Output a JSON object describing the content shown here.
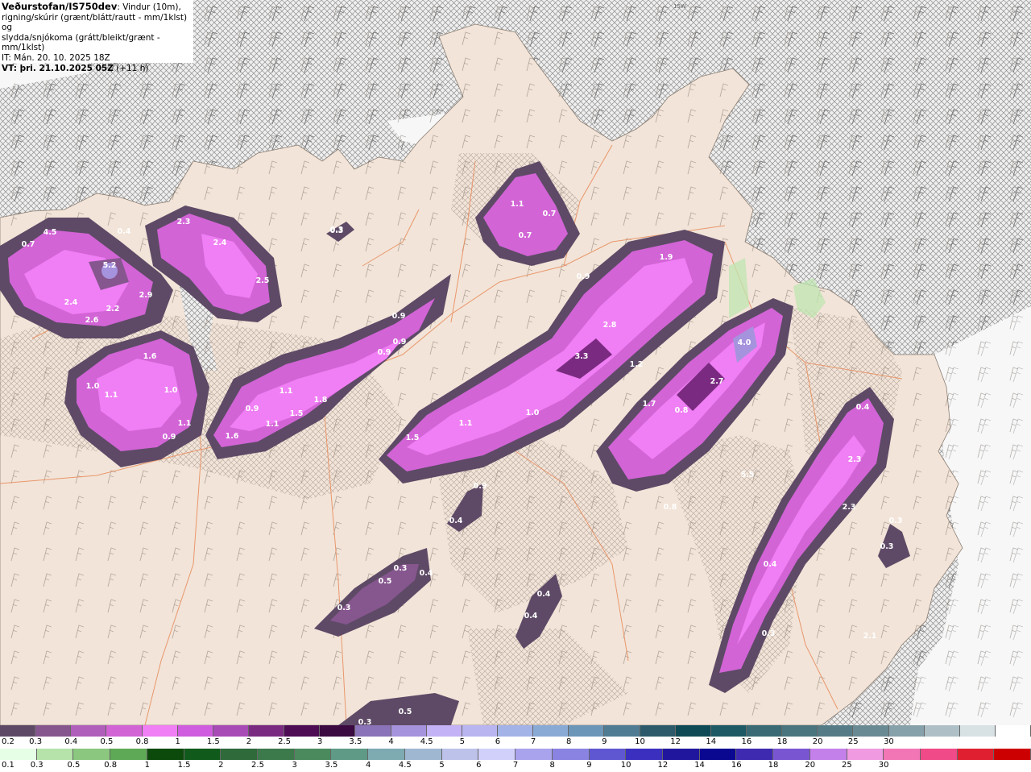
{
  "header": {
    "org": "Veðurstofan/IS750dev",
    "desc1": ": Vindur (10m),",
    "desc2": "rigning/skúrir (grænt/blátt/rautt - mm/1klst) og",
    "desc3": "slydda/snjókoma (grátt/bleikt/grænt - mm/1klst)",
    "it": "IT: Mán. 20. 10. 2025 18Z",
    "vt": "VT: þri. 21.10.2025 05Z",
    "lead": "(+11 h)"
  },
  "map_labels": [
    "0.7",
    "4.5",
    "0.4",
    "2.3",
    "2.4",
    "5.2",
    "2.5",
    "2.4",
    "2.2",
    "2.9",
    "2.6",
    "0.3",
    "1.1",
    "0.7",
    "0.7",
    "0.9",
    "1.9",
    "0.9",
    "0.9",
    "0.9",
    "2.8",
    "3.3",
    "1.2",
    "1.6",
    "1.0",
    "1.1",
    "1.0",
    "1.1",
    "0.9",
    "0.9",
    "1.1",
    "1.8",
    "1.5",
    "1.6",
    "1.1",
    "1.1",
    "1.5",
    "1.0",
    "1.7",
    "0.8",
    "2.7",
    "4.0",
    "5.5",
    "0.8",
    "0.4",
    "2.3",
    "2.3",
    "0.9",
    "0.4",
    "0.3",
    "0.3",
    "0.5",
    "0.4",
    "0.3",
    "0.3",
    "0.4",
    "0.4",
    "0.4",
    "0.3",
    "2.1",
    "0.5",
    "0.3",
    "0.3",
    "0.3"
  ],
  "snow_legend": {
    "colors": [
      "#5e4a66",
      "#86568e",
      "#b05fba",
      "#d264d6",
      "#f07ef4",
      "#d05cdf",
      "#a84bb6",
      "#7a2a80",
      "#4e0c55",
      "#3a0a40",
      "#8a73b8",
      "#a693dd",
      "#c3b2f5",
      "#b9b5f0",
      "#a3b3e8",
      "#8aaad6",
      "#6c96b8",
      "#4f7c93",
      "#2d5a6a",
      "#0d4a56",
      "#1d5a66",
      "#3a6a74",
      "#4a747e",
      "#557c86",
      "#6a8a93",
      "#87a1aa",
      "#aebfc6",
      "#d8e1e4",
      "#ffffff"
    ],
    "labels": [
      "0.2",
      "0.3",
      "0.4",
      "0.5",
      "0.8",
      "1",
      "1.5",
      "2",
      "2.5",
      "3",
      "3.5",
      "4",
      "4.5",
      "5",
      "6",
      "7",
      "8",
      "9",
      "10",
      "12",
      "14",
      "16",
      "18",
      "20",
      "25",
      "30"
    ]
  },
  "rain_legend": {
    "colors": [
      "#e6fde6",
      "#b5e3a9",
      "#8bc77e",
      "#5ea955",
      "#0c4a0c",
      "#105a1b",
      "#2e6a3a",
      "#3c7a4c",
      "#4a8a5d",
      "#5e9a86",
      "#7eaab2",
      "#9fb7d1",
      "#bcc2ea",
      "#d0d0fb",
      "#a9a3ee",
      "#8a83e2",
      "#5f56d2",
      "#3a2fbe",
      "#20169e",
      "#0a0790",
      "#3d2ab0",
      "#7a55d2",
      "#c480ea",
      "#f09ae2",
      "#f276b6",
      "#f04a88",
      "#e02030",
      "#cc0000"
    ],
    "labels": [
      "0.1",
      "0.3",
      "0.5",
      "0.8",
      "1",
      "1.5",
      "2",
      "2.5",
      "3",
      "3.5",
      "4",
      "4.5",
      "5",
      "6",
      "7",
      "8",
      "9",
      "10",
      "12",
      "14",
      "16",
      "18",
      "20",
      "25",
      "30"
    ]
  },
  "direction_marker": "15W",
  "colors": {
    "land": "#f2e4d8",
    "sea": "#e9e9e9",
    "hatch": "#8f8f8f",
    "road": "#e88a5a"
  }
}
